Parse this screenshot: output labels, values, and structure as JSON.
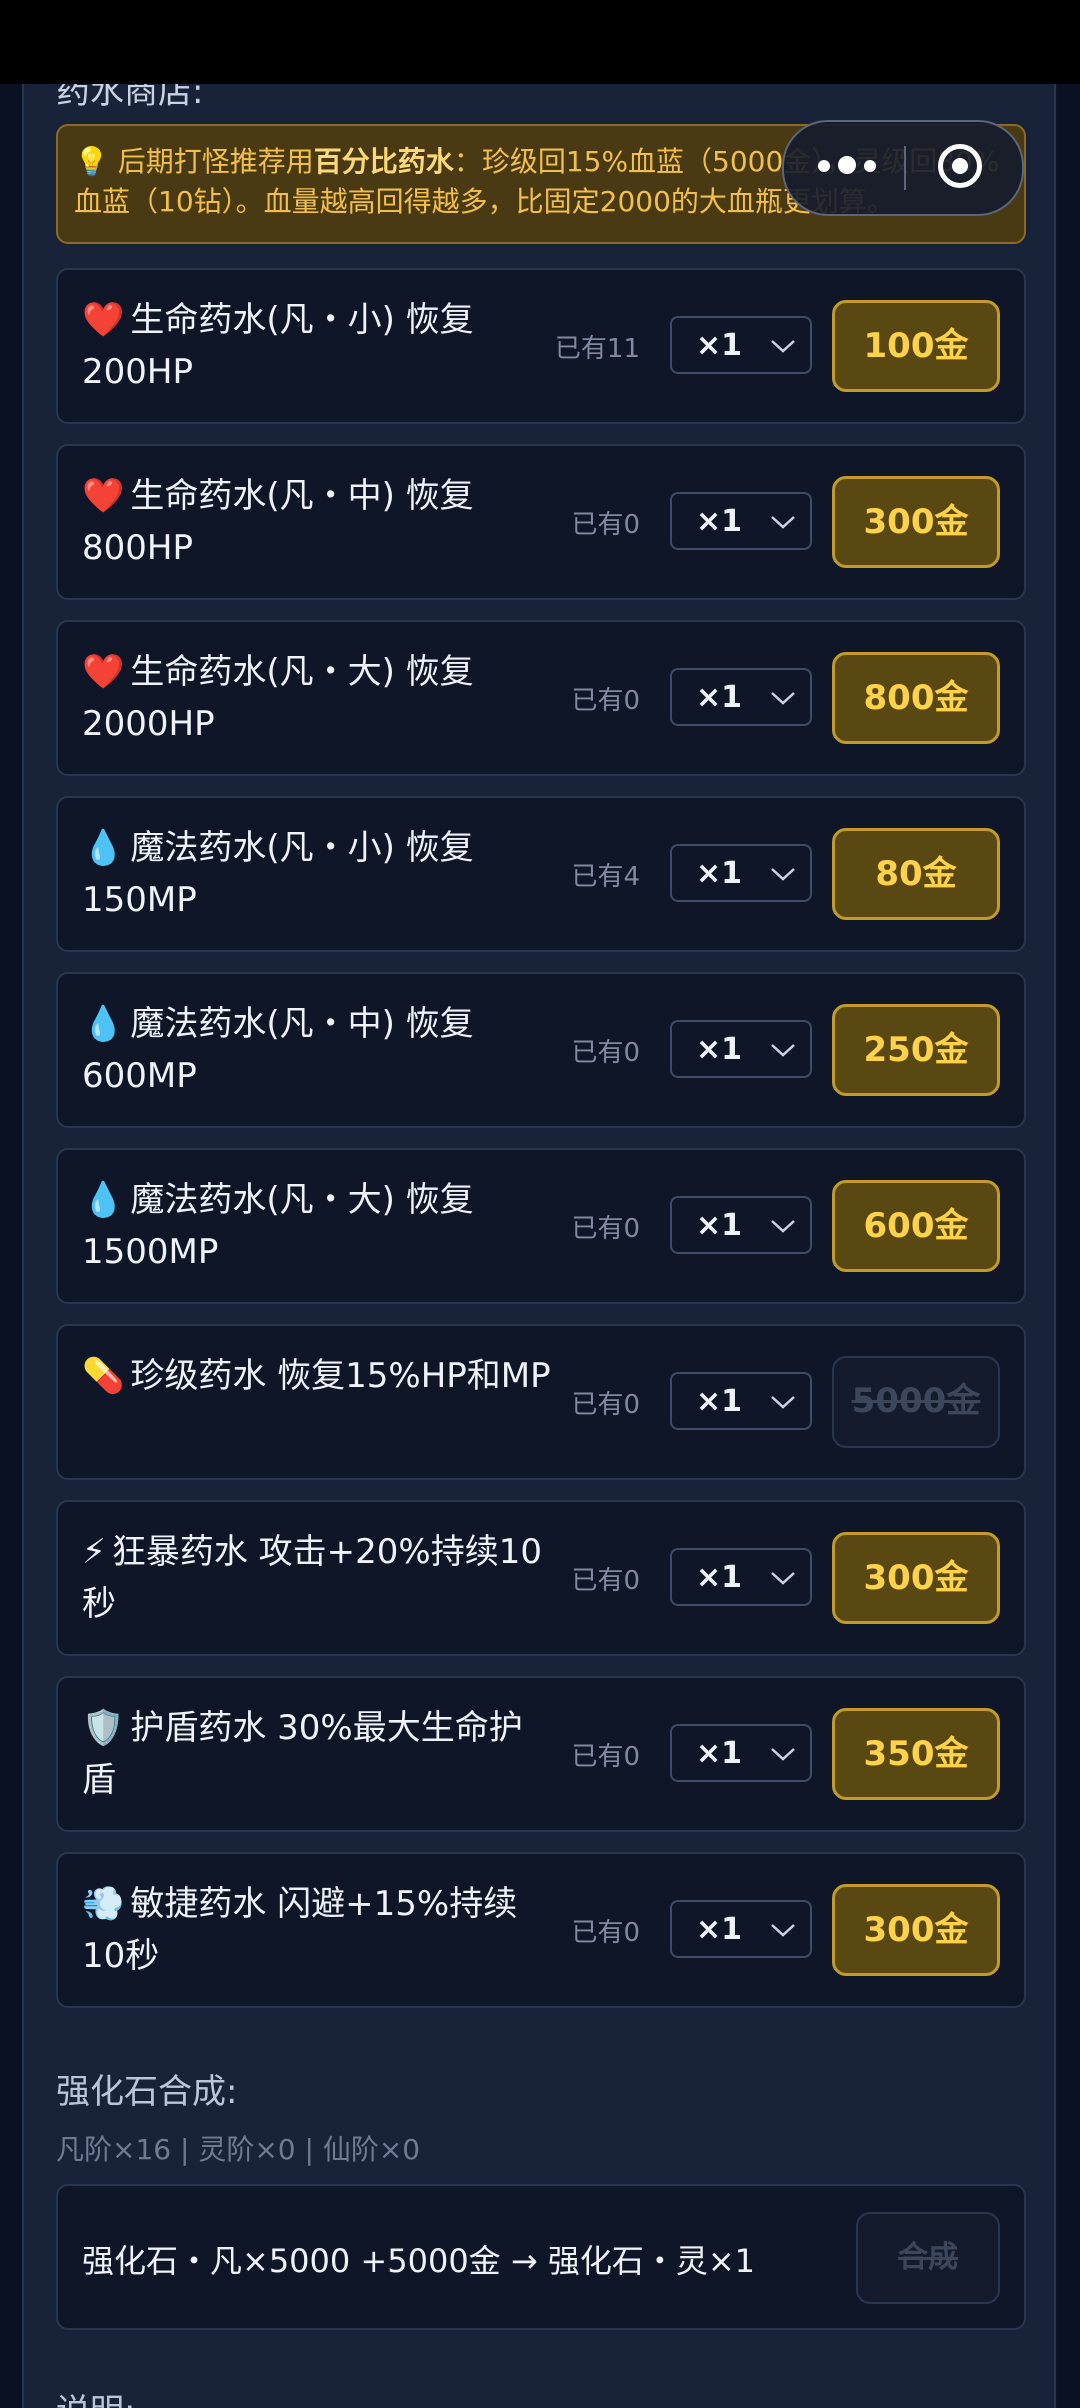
{
  "header": {
    "section_title": "药水商店:"
  },
  "tip": {
    "icon": "lightbulb-icon",
    "emoji": "💡",
    "text_before": "后期打怪推荐用",
    "highlight": "百分比药水",
    "text_after": "：珍级回15%血蓝（5000金），灵级回30%血蓝（10钻）。血量越高回得越多，比固定2000的大血瓶更划算。"
  },
  "capsule": {
    "more_icon": "more-dots-icon",
    "close_icon": "target-circle-icon"
  },
  "potions": [
    {
      "emoji": "❤️",
      "icon": "heart-icon",
      "name": "生命药水(凡・小) 恢复200HP",
      "owned": "已有11",
      "qty": "×1",
      "price": "100金",
      "enabled": true
    },
    {
      "emoji": "❤️",
      "icon": "heart-icon",
      "name": "生命药水(凡・中) 恢复800HP",
      "owned": "已有0",
      "qty": "×1",
      "price": "300金",
      "enabled": true
    },
    {
      "emoji": "❤️",
      "icon": "heart-icon",
      "name": "生命药水(凡・大) 恢复2000HP",
      "owned": "已有0",
      "qty": "×1",
      "price": "800金",
      "enabled": true
    },
    {
      "emoji": "💧",
      "icon": "droplet-icon",
      "name": "魔法药水(凡・小) 恢复150MP",
      "owned": "已有4",
      "qty": "×1",
      "price": "80金",
      "enabled": true
    },
    {
      "emoji": "💧",
      "icon": "droplet-icon",
      "name": "魔法药水(凡・中) 恢复600MP",
      "owned": "已有0",
      "qty": "×1",
      "price": "250金",
      "enabled": true
    },
    {
      "emoji": "💧",
      "icon": "droplet-icon",
      "name": "魔法药水(凡・大) 恢复1500MP",
      "owned": "已有0",
      "qty": "×1",
      "price": "600金",
      "enabled": true
    },
    {
      "emoji": "💊",
      "icon": "pill-icon",
      "name": "珍级药水 恢复15%HP和MP",
      "owned": "已有0",
      "qty": "×1",
      "price": "5000金",
      "enabled": false
    },
    {
      "emoji": "⚡",
      "icon": "lightning-icon",
      "name": "狂暴药水 攻击+20%持续10秒",
      "owned": "已有0",
      "qty": "×1",
      "price": "300金",
      "enabled": true
    },
    {
      "emoji": "🛡️",
      "icon": "shield-icon",
      "name": "护盾药水 30%最大生命护盾",
      "owned": "已有0",
      "qty": "×1",
      "price": "350金",
      "enabled": true
    },
    {
      "emoji": "💨",
      "icon": "dash-icon",
      "name": "敏捷药水 闪避+15%持续10秒",
      "owned": "已有0",
      "qty": "×1",
      "price": "300金",
      "enabled": true
    }
  ],
  "stone": {
    "title": "强化石合成:",
    "inventory": "凡阶×16 | 灵阶×0 | 仙阶×0",
    "recipe": "强化石・凡×5000 +5000金 → 强化石・灵×1",
    "button": "合成"
  },
  "footer": {
    "section_title": "说明:"
  }
}
